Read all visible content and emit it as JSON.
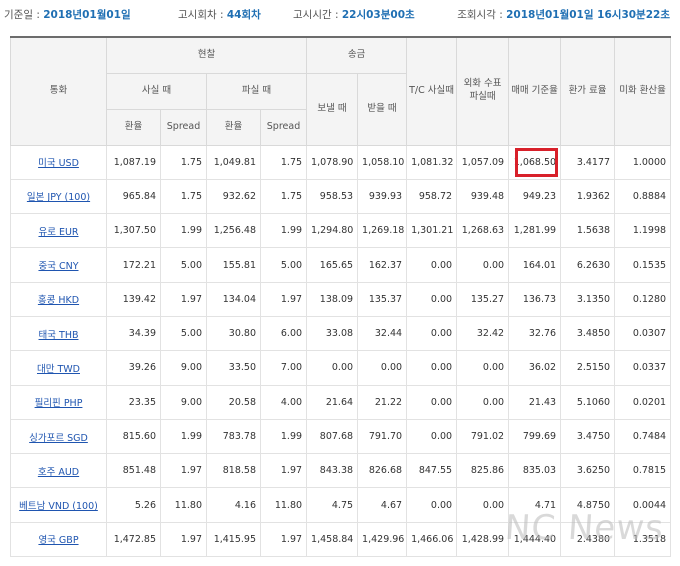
{
  "meta": {
    "base_date_label": "기준일 :",
    "base_date": "2018년01월01일",
    "notice_round_label": "고시회차 :",
    "notice_round": "44회차",
    "notice_time_label": "고시시간 :",
    "notice_time": "22시03분00초",
    "query_time_label": "조회시각 :",
    "query_time": "2018년01월01일 16시30분22초"
  },
  "headers": {
    "currency": "통화",
    "cash": "현찰",
    "remit": "송금",
    "cash_buy": "사실 때",
    "cash_sell": "파실 때",
    "rate": "환율",
    "spread": "Spread",
    "send": "보낼 때",
    "receive": "받을 때",
    "tc": "T/C 사실때",
    "check": "외화 수표 파실때",
    "base_rate": "매매 기준율",
    "conv_rate": "환가 료율",
    "usd_conv": "미화 환산율"
  },
  "rows": [
    {
      "currency": "미국 USD",
      "cash_buy": "1,087.19",
      "cash_buy_spread": "1.75",
      "cash_sell": "1,049.81",
      "cash_sell_spread": "1.75",
      "send": "1,078.90",
      "receive": "1,058.10",
      "tc": "1,081.32",
      "check": "1,057.09",
      "base": "1,068.50",
      "conv": "3.4177",
      "usd": "1.0000"
    },
    {
      "currency": "일본 JPY (100)",
      "cash_buy": "965.84",
      "cash_buy_spread": "1.75",
      "cash_sell": "932.62",
      "cash_sell_spread": "1.75",
      "send": "958.53",
      "receive": "939.93",
      "tc": "958.72",
      "check": "939.48",
      "base": "949.23",
      "conv": "1.9362",
      "usd": "0.8884"
    },
    {
      "currency": "유로 EUR",
      "cash_buy": "1,307.50",
      "cash_buy_spread": "1.99",
      "cash_sell": "1,256.48",
      "cash_sell_spread": "1.99",
      "send": "1,294.80",
      "receive": "1,269.18",
      "tc": "1,301.21",
      "check": "1,268.63",
      "base": "1,281.99",
      "conv": "1.5638",
      "usd": "1.1998"
    },
    {
      "currency": "중국 CNY",
      "cash_buy": "172.21",
      "cash_buy_spread": "5.00",
      "cash_sell": "155.81",
      "cash_sell_spread": "5.00",
      "send": "165.65",
      "receive": "162.37",
      "tc": "0.00",
      "check": "0.00",
      "base": "164.01",
      "conv": "6.2630",
      "usd": "0.1535"
    },
    {
      "currency": "홍콩 HKD",
      "cash_buy": "139.42",
      "cash_buy_spread": "1.97",
      "cash_sell": "134.04",
      "cash_sell_spread": "1.97",
      "send": "138.09",
      "receive": "135.37",
      "tc": "0.00",
      "check": "135.27",
      "base": "136.73",
      "conv": "3.1350",
      "usd": "0.1280"
    },
    {
      "currency": "태국 THB",
      "cash_buy": "34.39",
      "cash_buy_spread": "5.00",
      "cash_sell": "30.80",
      "cash_sell_spread": "6.00",
      "send": "33.08",
      "receive": "32.44",
      "tc": "0.00",
      "check": "32.42",
      "base": "32.76",
      "conv": "3.4850",
      "usd": "0.0307"
    },
    {
      "currency": "대만 TWD",
      "cash_buy": "39.26",
      "cash_buy_spread": "9.00",
      "cash_sell": "33.50",
      "cash_sell_spread": "7.00",
      "send": "0.00",
      "receive": "0.00",
      "tc": "0.00",
      "check": "0.00",
      "base": "36.02",
      "conv": "2.5150",
      "usd": "0.0337"
    },
    {
      "currency": "필리핀 PHP",
      "cash_buy": "23.35",
      "cash_buy_spread": "9.00",
      "cash_sell": "20.58",
      "cash_sell_spread": "4.00",
      "send": "21.64",
      "receive": "21.22",
      "tc": "0.00",
      "check": "0.00",
      "base": "21.43",
      "conv": "5.1060",
      "usd": "0.0201"
    },
    {
      "currency": "싱가포르 SGD",
      "cash_buy": "815.60",
      "cash_buy_spread": "1.99",
      "cash_sell": "783.78",
      "cash_sell_spread": "1.99",
      "send": "807.68",
      "receive": "791.70",
      "tc": "0.00",
      "check": "791.02",
      "base": "799.69",
      "conv": "3.4750",
      "usd": "0.7484"
    },
    {
      "currency": "호주 AUD",
      "cash_buy": "851.48",
      "cash_buy_spread": "1.97",
      "cash_sell": "818.58",
      "cash_sell_spread": "1.97",
      "send": "843.38",
      "receive": "826.68",
      "tc": "847.55",
      "check": "825.86",
      "base": "835.03",
      "conv": "3.6250",
      "usd": "0.7815"
    },
    {
      "currency": "베트남 VND (100)",
      "cash_buy": "5.26",
      "cash_buy_spread": "11.80",
      "cash_sell": "4.16",
      "cash_sell_spread": "11.80",
      "send": "4.75",
      "receive": "4.67",
      "tc": "0.00",
      "check": "0.00",
      "base": "4.71",
      "conv": "4.8750",
      "usd": "0.0044"
    },
    {
      "currency": "영국 GBP",
      "cash_buy": "1,472.85",
      "cash_buy_spread": "1.97",
      "cash_sell": "1,415.95",
      "cash_sell_spread": "1.97",
      "send": "1,458.84",
      "receive": "1,429.96",
      "tc": "1,466.06",
      "check": "1,428.99",
      "base": "1,444.40",
      "conv": "2.4380",
      "usd": "1.3518"
    }
  ],
  "highlight": {
    "row": 0,
    "column": "base",
    "color": "#d8202a"
  },
  "colors": {
    "accent": "#1f6fb3",
    "link": "#1f55b0",
    "header_bg": "#f4f4f4"
  },
  "watermark": "NC News"
}
